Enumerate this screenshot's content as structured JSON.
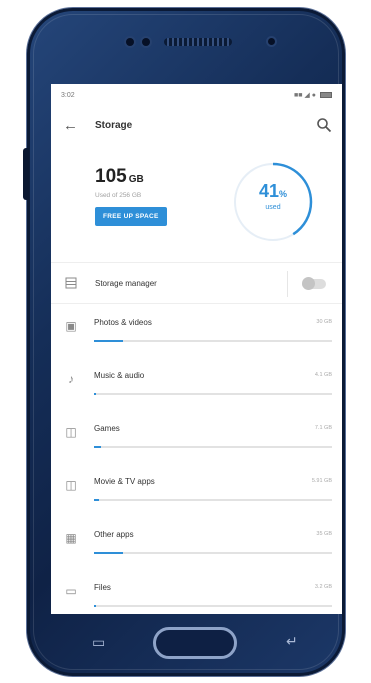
{
  "status_bar": {
    "time": "3:02",
    "signal_text": "■■ ◢ ●"
  },
  "toolbar": {
    "title": "Storage",
    "back_icon": "arrow-back-icon",
    "search_icon": "search-icon"
  },
  "summary": {
    "used_value": "105",
    "used_unit": "GB",
    "used_of": "Used of 256 GB",
    "free_button": "FREE UP SPACE",
    "percent_value": "41",
    "percent_symbol": "%",
    "percent_label": "used",
    "percent_fraction": 0.41
  },
  "storage_manager": {
    "label": "Storage manager",
    "enabled": false
  },
  "categories": [
    {
      "label": "Photos & videos",
      "size": "30 GB",
      "icon": "photo-icon",
      "fraction": 0.12
    },
    {
      "label": "Music & audio",
      "size": "4.1 GB",
      "icon": "music-note-icon",
      "fraction": 0.01
    },
    {
      "label": "Games",
      "size": "7.1 GB",
      "icon": "games-icon",
      "fraction": 0.03
    },
    {
      "label": "Movie & TV apps",
      "size": "5.91 GB",
      "icon": "video-camera-icon",
      "fraction": 0.02
    },
    {
      "label": "Other apps",
      "size": "35 GB",
      "icon": "apps-grid-icon",
      "fraction": 0.12
    },
    {
      "label": "Files",
      "size": "3.2 GB",
      "icon": "folder-icon",
      "fraction": 0.01
    }
  ],
  "colors": {
    "accent": "#2e8fd8",
    "phone_body": "#152e58"
  }
}
